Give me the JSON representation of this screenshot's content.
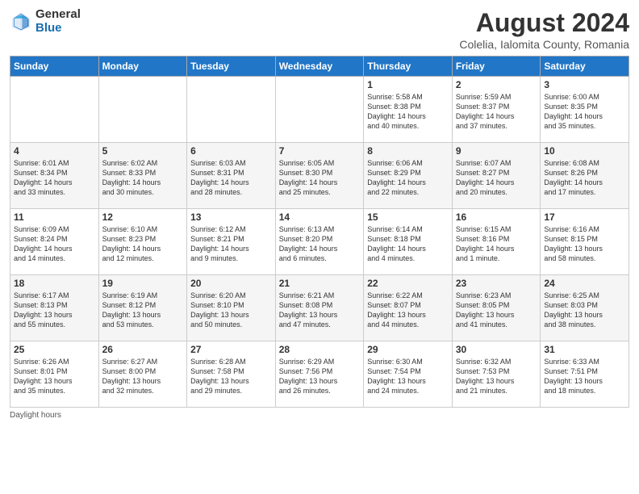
{
  "logo": {
    "general": "General",
    "blue": "Blue"
  },
  "title": "August 2024",
  "subtitle": "Colelia, Ialomita County, Romania",
  "headers": [
    "Sunday",
    "Monday",
    "Tuesday",
    "Wednesday",
    "Thursday",
    "Friday",
    "Saturday"
  ],
  "weeks": [
    [
      {
        "day": "",
        "info": ""
      },
      {
        "day": "",
        "info": ""
      },
      {
        "day": "",
        "info": ""
      },
      {
        "day": "",
        "info": ""
      },
      {
        "day": "1",
        "info": "Sunrise: 5:58 AM\nSunset: 8:38 PM\nDaylight: 14 hours\nand 40 minutes."
      },
      {
        "day": "2",
        "info": "Sunrise: 5:59 AM\nSunset: 8:37 PM\nDaylight: 14 hours\nand 37 minutes."
      },
      {
        "day": "3",
        "info": "Sunrise: 6:00 AM\nSunset: 8:35 PM\nDaylight: 14 hours\nand 35 minutes."
      }
    ],
    [
      {
        "day": "4",
        "info": "Sunrise: 6:01 AM\nSunset: 8:34 PM\nDaylight: 14 hours\nand 33 minutes."
      },
      {
        "day": "5",
        "info": "Sunrise: 6:02 AM\nSunset: 8:33 PM\nDaylight: 14 hours\nand 30 minutes."
      },
      {
        "day": "6",
        "info": "Sunrise: 6:03 AM\nSunset: 8:31 PM\nDaylight: 14 hours\nand 28 minutes."
      },
      {
        "day": "7",
        "info": "Sunrise: 6:05 AM\nSunset: 8:30 PM\nDaylight: 14 hours\nand 25 minutes."
      },
      {
        "day": "8",
        "info": "Sunrise: 6:06 AM\nSunset: 8:29 PM\nDaylight: 14 hours\nand 22 minutes."
      },
      {
        "day": "9",
        "info": "Sunrise: 6:07 AM\nSunset: 8:27 PM\nDaylight: 14 hours\nand 20 minutes."
      },
      {
        "day": "10",
        "info": "Sunrise: 6:08 AM\nSunset: 8:26 PM\nDaylight: 14 hours\nand 17 minutes."
      }
    ],
    [
      {
        "day": "11",
        "info": "Sunrise: 6:09 AM\nSunset: 8:24 PM\nDaylight: 14 hours\nand 14 minutes."
      },
      {
        "day": "12",
        "info": "Sunrise: 6:10 AM\nSunset: 8:23 PM\nDaylight: 14 hours\nand 12 minutes."
      },
      {
        "day": "13",
        "info": "Sunrise: 6:12 AM\nSunset: 8:21 PM\nDaylight: 14 hours\nand 9 minutes."
      },
      {
        "day": "14",
        "info": "Sunrise: 6:13 AM\nSunset: 8:20 PM\nDaylight: 14 hours\nand 6 minutes."
      },
      {
        "day": "15",
        "info": "Sunrise: 6:14 AM\nSunset: 8:18 PM\nDaylight: 14 hours\nand 4 minutes."
      },
      {
        "day": "16",
        "info": "Sunrise: 6:15 AM\nSunset: 8:16 PM\nDaylight: 14 hours\nand 1 minute."
      },
      {
        "day": "17",
        "info": "Sunrise: 6:16 AM\nSunset: 8:15 PM\nDaylight: 13 hours\nand 58 minutes."
      }
    ],
    [
      {
        "day": "18",
        "info": "Sunrise: 6:17 AM\nSunset: 8:13 PM\nDaylight: 13 hours\nand 55 minutes."
      },
      {
        "day": "19",
        "info": "Sunrise: 6:19 AM\nSunset: 8:12 PM\nDaylight: 13 hours\nand 53 minutes."
      },
      {
        "day": "20",
        "info": "Sunrise: 6:20 AM\nSunset: 8:10 PM\nDaylight: 13 hours\nand 50 minutes."
      },
      {
        "day": "21",
        "info": "Sunrise: 6:21 AM\nSunset: 8:08 PM\nDaylight: 13 hours\nand 47 minutes."
      },
      {
        "day": "22",
        "info": "Sunrise: 6:22 AM\nSunset: 8:07 PM\nDaylight: 13 hours\nand 44 minutes."
      },
      {
        "day": "23",
        "info": "Sunrise: 6:23 AM\nSunset: 8:05 PM\nDaylight: 13 hours\nand 41 minutes."
      },
      {
        "day": "24",
        "info": "Sunrise: 6:25 AM\nSunset: 8:03 PM\nDaylight: 13 hours\nand 38 minutes."
      }
    ],
    [
      {
        "day": "25",
        "info": "Sunrise: 6:26 AM\nSunset: 8:01 PM\nDaylight: 13 hours\nand 35 minutes."
      },
      {
        "day": "26",
        "info": "Sunrise: 6:27 AM\nSunset: 8:00 PM\nDaylight: 13 hours\nand 32 minutes."
      },
      {
        "day": "27",
        "info": "Sunrise: 6:28 AM\nSunset: 7:58 PM\nDaylight: 13 hours\nand 29 minutes."
      },
      {
        "day": "28",
        "info": "Sunrise: 6:29 AM\nSunset: 7:56 PM\nDaylight: 13 hours\nand 26 minutes."
      },
      {
        "day": "29",
        "info": "Sunrise: 6:30 AM\nSunset: 7:54 PM\nDaylight: 13 hours\nand 24 minutes."
      },
      {
        "day": "30",
        "info": "Sunrise: 6:32 AM\nSunset: 7:53 PM\nDaylight: 13 hours\nand 21 minutes."
      },
      {
        "day": "31",
        "info": "Sunrise: 6:33 AM\nSunset: 7:51 PM\nDaylight: 13 hours\nand 18 minutes."
      }
    ]
  ],
  "footer": "Daylight hours"
}
